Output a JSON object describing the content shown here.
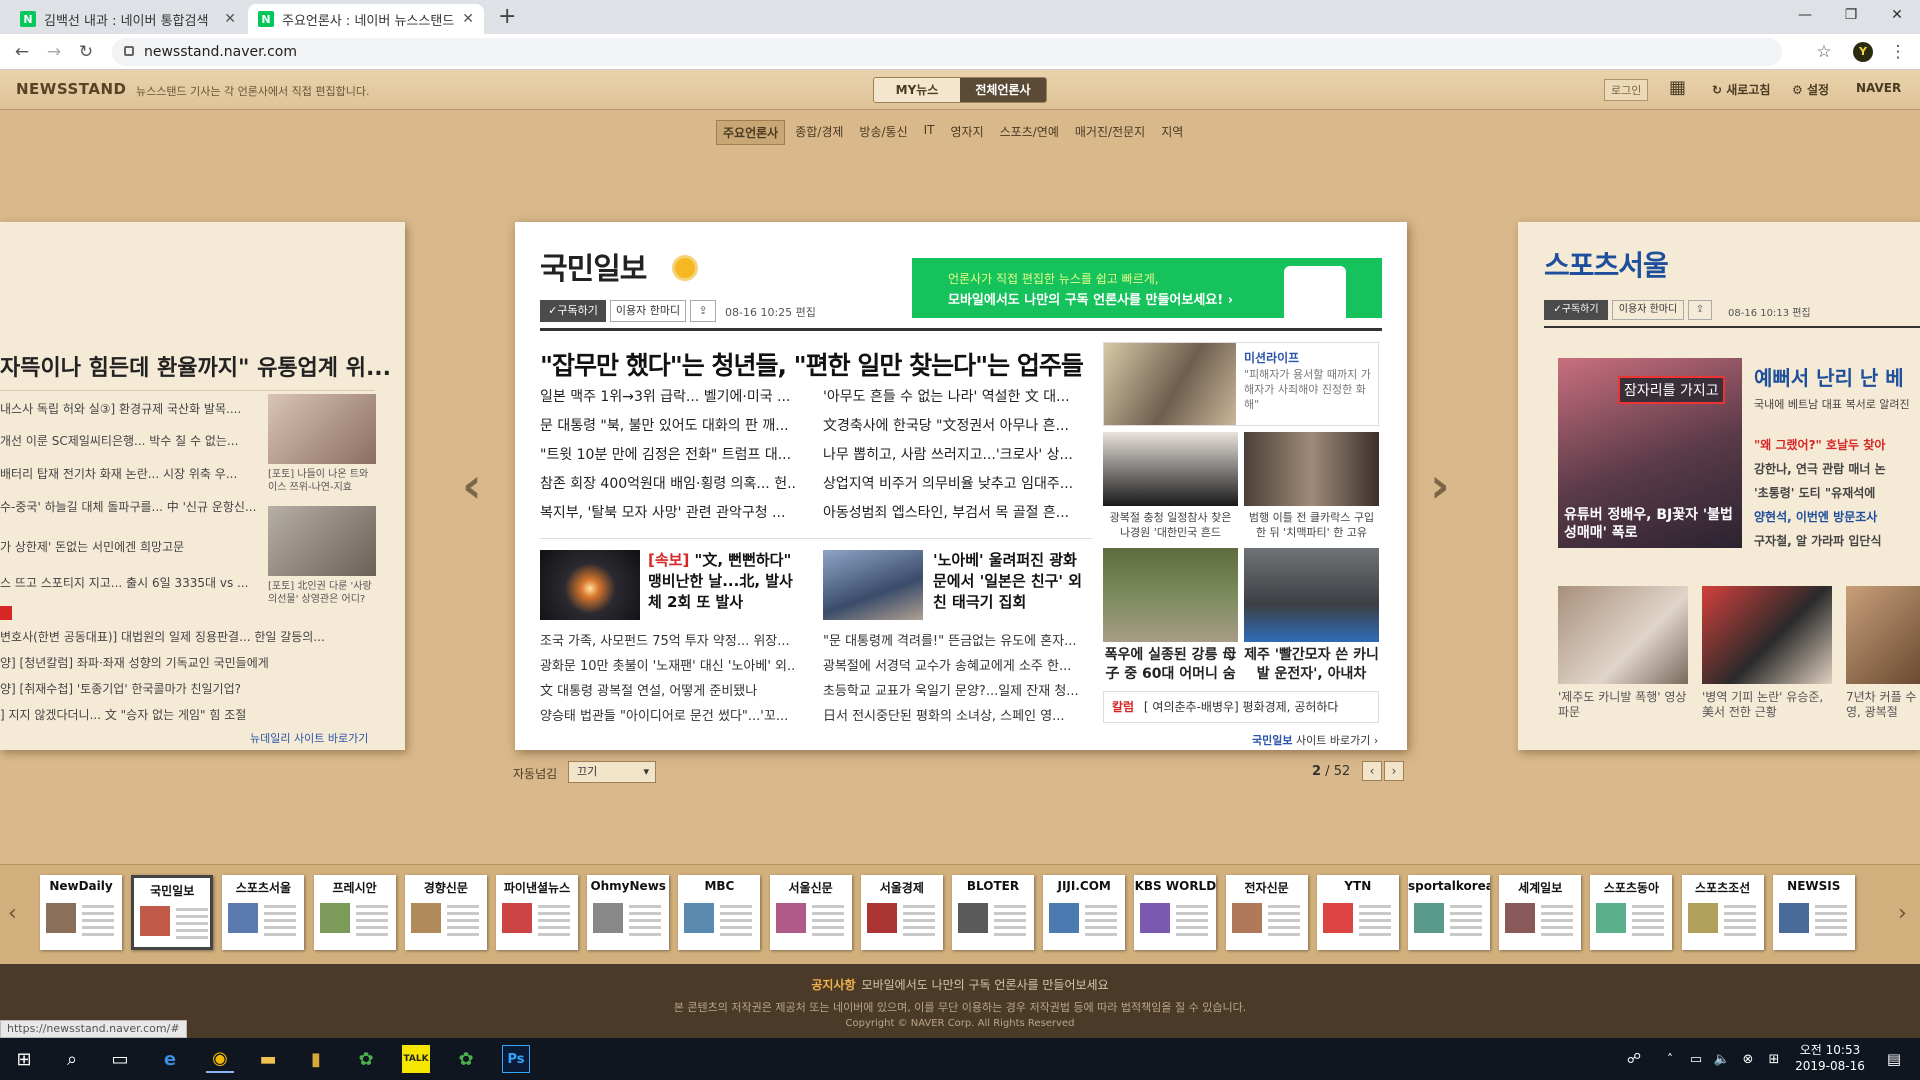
{
  "browser": {
    "tabs": [
      {
        "title": "김백선 내과 : 네이버 통합검색",
        "favicon": "N"
      },
      {
        "title": "주요언론사 : 네이버 뉴스스탠드",
        "favicon": "N"
      }
    ],
    "new_tab": "+",
    "url": "newsstand.naver.com",
    "profile_initial": "Y"
  },
  "header": {
    "logo": "NEWSSTAND",
    "tagline": "뉴스스탠드 기사는 각 언론사에서 직접 편집합니다.",
    "toggle_my": "MY뉴스",
    "toggle_all": "전체언론사",
    "login": "로그인",
    "refresh": "새로고침",
    "settings": "설정",
    "naver": "NAVER"
  },
  "categories": [
    "주요언론사",
    "종합/경제",
    "방송/통신",
    "IT",
    "영자지",
    "스포츠/연예",
    "매거진/전문지",
    "지역"
  ],
  "left_panel": {
    "headline": "자뜩이나 힘든데 환율까지\" 유통업계 위...",
    "lines": [
      "내스사 독립 허와 실③] 환경규제 국산화 발목....",
      "개선 이룬 SC제일씨티은행... 박수 칠 수 없는...",
      "배터리 탑재 전기차 화재 논란... 시장 위축 우...",
      "수-중국' 하늘길 대체 돌파구를... 中 '신규 운항신...",
      "가 상한제' 돈없는 서민에겐 희망고문",
      "스 뜨고 스포티지 지고... 출시 6일 3335대 vs ..."
    ],
    "captions": [
      "[포토] 나들이 나온 트와이스 쯔위-나연-지효",
      "[포토] 北인권 다룬 '사랑의선물' 상영관은 어디?"
    ],
    "lines2": [
      "변호사(한변 공동대표)] 대법원의 일제 징용판결... 한일 갈등의...",
      "양] [청년칼럼] 좌파·좌재 성향의 기독교인 국민들에게",
      "양] [취재수첩] '토종기업' 한국콜마가 친일기업?",
      "] 지지 않겠다더니... 文 \"승자 없는 게임\" 힘 조절"
    ],
    "site_link": "뉴데일리 사이트 바로가기"
  },
  "main": {
    "publication": "국민일보",
    "subscribe": "✓구독하기",
    "user_say": "이용자 한마디",
    "edit_time": "08-16 10:25 편집",
    "banner_line1": "언론사가 직접 편집한 뉴스를 쉽고 빠르게,",
    "banner_line2": "모바일에서도 나만의 구독 언론사를 만들어보세요! ›",
    "top_headline": "\"잡무만 했다\"는 청년들, \"편한 일만 찾는다\"는 업주들",
    "headlines_left": [
      "일본 맥주 1위→3위 급락... 벨기에·미국 ...",
      "문 대통령 \"북, 불만 있어도 대화의 판 깨...",
      "\"트윗 10분 만에 김정은 전화\" 트럼프 대...",
      "참존 회장 400억원대 배임·횡령 의혹... 헌...",
      "복지부, '탈북 모자 사망' 관련 관악구청 ..."
    ],
    "headlines_right": [
      "'아무도 흔들 수 없는 나라' 역설한 文 대...",
      "文경축사에 한국당 \"文정권서 아무나 흔...",
      "나무 뽑히고, 사람 쓰러지고...'크로사' 상...",
      "상업지역 비주거 의무비율 낮추고 임대주...",
      "아동성범죄 엡스타인, 부검서 목 골절 흔..."
    ],
    "feature1": {
      "tag": "[속보]",
      "text": "\"文, 뻔뻔하다\" 맹비난한 날...北, 발사체 2회 또 발사"
    },
    "feature2": {
      "text": "'노아베' 울려퍼진 광화문에서 '일본은 친구' 외친 태극기 집회"
    },
    "sub_left": [
      "조국 가족, 사모펀드 75억 투자 약정... 위장...",
      "광화문 10만 촛불이 '노재팬' 대신 '노아베' 외...",
      "文 대통령 광복절 연설, 어떻게 준비됐나",
      "양승태 법관들 \"아이디어로 문건 썼다\"...'꼬..."
    ],
    "sub_right": [
      "\"문 대통령께 격려를!\" 뜬금없는 유도에 혼자...",
      "광복절에 서경덕 교수가 송혜교에게 소주 한...",
      "초등학교 교표가 욱일기 문양?...일제 잔재 청...",
      "日서 전시중단된 평화의 소녀상, 스페인 영..."
    ],
    "mission_label": "미션라이프",
    "mission_text": "\"피해자가 용서할 때까지 가해자가 사죄해야 진정한 화해\"",
    "cap1": "광복절 충청 일정참사 찾은 나경원 '대한민국 흔드",
    "cap2": "범행 이틀 전 클카락스 구입한 뒤 '치맥파티' 한 고유",
    "cap3": "폭우에 실종된 강릉 母子 중 60대 어머니 숨",
    "cap4": "제주 '빨간모자 쓴 카니발 운전자', 아내차",
    "column_label": "칼럼",
    "column_text": "[ 여의춘추-배병우] 평화경제, 공허하다",
    "site_pub": "국민일보",
    "site_link": "사이트 바로가기 ›"
  },
  "right_panel": {
    "publication": "스포츠서울",
    "subscribe": "✓구독하기",
    "user_say": "이용자 한마디",
    "edit_time": "08-16 10:13 편집",
    "photo_overlay": "잠자리를 가지고",
    "photo_caption": "유튜버 정배우, BJ꽃자 '불법 성매매' 폭로",
    "headline": "예뻐서 난리 난 베",
    "lines": [
      "국내에 베트남 대표 복서로 알려진",
      "\"왜 그랬어?\" 호날두 찾아",
      "강한나, 연극 관람 매너 논",
      "'초통령' 도티 \"유재석에",
      "양현석, 이번엔 방문조사",
      "구자철, 알 가라파 입단식"
    ],
    "captions": [
      "'제주도 카니발 폭행' 영상 파문",
      "'병역 기피 논란' 유승준, 美서 전한 근황",
      "7년차 커플 수영, 광복절"
    ]
  },
  "pager": {
    "autoflip_label": "자동넘김",
    "autoflip_value": "끄기",
    "current": "2",
    "total": "/ 52"
  },
  "thumbnails": [
    "NewDaily",
    "국민일보",
    "스포츠서울",
    "프레시안",
    "경향신문",
    "파이낸셜뉴스",
    "OhmyNews",
    "MBC",
    "서울신문",
    "서울경제",
    "BLOTER",
    "JIJI.COM",
    "KBS WORLD",
    "전자신문",
    "YTN",
    "sportalkorea",
    "세계일보",
    "스포츠동아",
    "스포츠조선",
    "NEWSIS"
  ],
  "footer": {
    "notice_label": "공지사항",
    "notice_text": "모바일에서도 나만의 구독 언론사를 만들어보세요",
    "copyright_line": "본 콘텐츠의 저작권은 제공처 또는 네이버에 있으며, 이를 무단 이용하는 경우 저작권법 등에 따라 법적책임을 질 수 있습니다.",
    "copyright": "Copyright © NAVER Corp. All Rights Reserved",
    "status_url": "https://newsstand.naver.com/#"
  },
  "taskbar": {
    "time": "오전 10:53",
    "date": "2019-08-16"
  },
  "colors": {
    "naver_green": "#03c75a",
    "accent_red": "#d62626",
    "link_blue": "#2a55a8"
  }
}
